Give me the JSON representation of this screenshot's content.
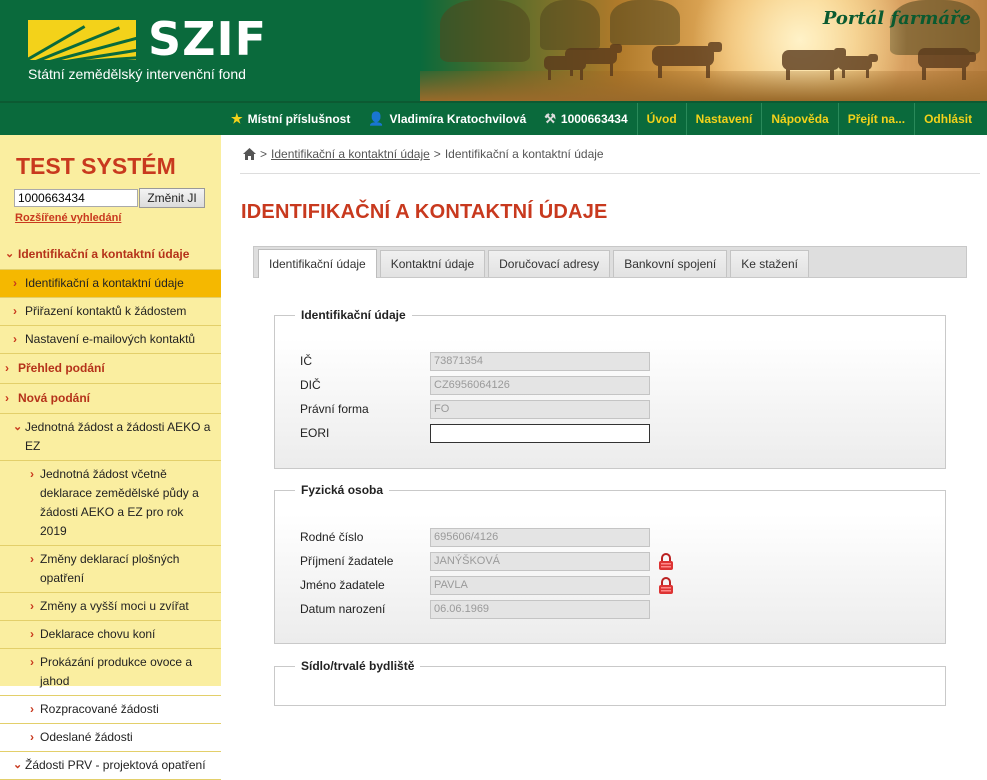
{
  "header": {
    "logo_text": "SZIF",
    "logo_subtitle": "Státní zemědělský intervenční fond",
    "portal_title": "Portál farmáře"
  },
  "topnav": {
    "items": [
      {
        "label": "Místní příslušnost",
        "icon": "star-icon"
      },
      {
        "label": "Vladimíra Kratochvilová",
        "icon": "user-icon"
      },
      {
        "label": "1000663434",
        "icon": "farmer-icon"
      },
      {
        "label": "Úvod"
      },
      {
        "label": "Nastavení"
      },
      {
        "label": "Nápověda"
      },
      {
        "label": "Přejít na..."
      },
      {
        "label": "Odhlásit"
      }
    ]
  },
  "sidebar": {
    "title": "TEST SYSTÉM",
    "ji_input_value": "1000663434",
    "change_button": "Změnit JI",
    "advanced_search": "Rozšířené vyhledání",
    "menu": [
      {
        "label": "Identifikační a kontaktní údaje",
        "level": 0,
        "open": true
      },
      {
        "label": "Identifikační a kontaktní údaje",
        "level": 1,
        "active": true
      },
      {
        "label": "Přiřazení kontaktů k žádostem",
        "level": 1
      },
      {
        "label": "Nastavení e-mailových kontaktů",
        "level": 1
      },
      {
        "label": "Přehled podání",
        "level": 0
      },
      {
        "label": "Nová podání",
        "level": 0
      },
      {
        "label": "Jednotná žádost a žádosti AEKO a EZ",
        "level": 1,
        "open": true
      },
      {
        "label": "Jednotná žádost včetně deklarace zemědělské půdy a žádosti AEKO a EZ pro rok 2019",
        "level": 2
      },
      {
        "label": "Změny deklarací plošných opatření",
        "level": 2
      },
      {
        "label": "Změny a vyšší moci u zvířat",
        "level": 2
      },
      {
        "label": "Deklarace chovu koní",
        "level": 2
      },
      {
        "label": "Prokázání produkce ovoce a jahod",
        "level": 2
      },
      {
        "label": "Rozpracované žádosti",
        "level": 2
      },
      {
        "label": "Odeslané žádosti",
        "level": 2
      },
      {
        "label": "Žádosti PRV - projektová opatření",
        "level": 1,
        "open": true
      }
    ]
  },
  "breadcrumb": {
    "items": [
      "Identifikační a kontaktní údaje",
      "Identifikační a kontaktní údaje"
    ],
    "separator": ">"
  },
  "page_title": "IDENTIFIKAČNÍ A KONTAKTNÍ ÚDAJE",
  "tabs": [
    {
      "label": "Identifikační údaje",
      "active": true
    },
    {
      "label": "Kontaktní údaje"
    },
    {
      "label": "Doručovací adresy"
    },
    {
      "label": "Bankovní spojení"
    },
    {
      "label": "Ke stažení"
    }
  ],
  "sections": {
    "identifikace": {
      "legend": "Identifikační údaje",
      "fields": [
        {
          "label": "IČ",
          "value": "73871354"
        },
        {
          "label": "DIČ",
          "value": "CZ6956064126"
        },
        {
          "label": "Právní forma",
          "value": "FO"
        },
        {
          "label": "EORI",
          "value": ""
        }
      ]
    },
    "fyzicka_osoba": {
      "legend": "Fyzická osoba",
      "fields": [
        {
          "label": "Rodné číslo",
          "value": "695606/4126"
        },
        {
          "label": "Příjmení žadatele",
          "value": "JANÝŠKOVÁ",
          "locked": true
        },
        {
          "label": "Jméno žadatele",
          "value": "PAVLA",
          "locked": true
        },
        {
          "label": "Datum narození",
          "value": "06.06.1969"
        }
      ]
    },
    "sidlo": {
      "legend": "Sídlo/trvalé bydliště"
    }
  },
  "colors": {
    "brand_green": "#0a6a3c",
    "brand_yellow": "#f3d21a",
    "accent_red": "#c8391e",
    "sidebar_bg": "#faeea0",
    "active_item": "#f5b800"
  }
}
